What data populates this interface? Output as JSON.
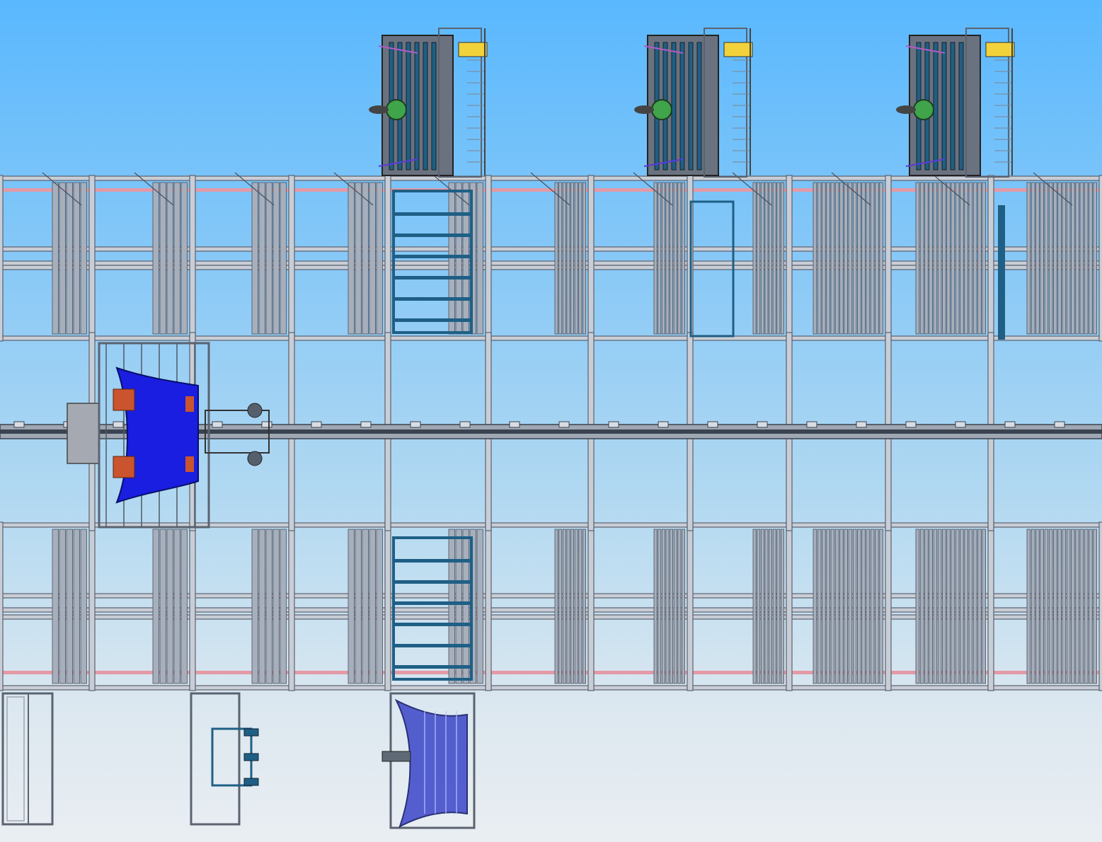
{
  "view": {
    "type": "CAD top view",
    "background_top": "#59b8fe",
    "background_bottom": "#e9eef2"
  },
  "colors": {
    "frame": "#5b6270",
    "frame_fill": "#c9ced6",
    "rack_slat": "#a7afbc",
    "rack_slat_dark": "#4a505c",
    "blue_steel": "#1f5f85",
    "part_blue": "#1a1ee0",
    "orange": "#c9542e",
    "yellow": "#f2d23a",
    "green": "#3fa44a",
    "pink": "#e39aa6",
    "rail": "#3a4350"
  },
  "objects": {
    "fixtures_top": [
      "fixture-1",
      "fixture-2",
      "fixture-3"
    ],
    "rack_rows": [
      "rack-row-top",
      "rack-row-bottom"
    ],
    "gantry": "gantry-robot-with-blue-part",
    "bottom_stations": [
      "empty-frame-station",
      "pallet-station",
      "blue-part-station"
    ]
  }
}
